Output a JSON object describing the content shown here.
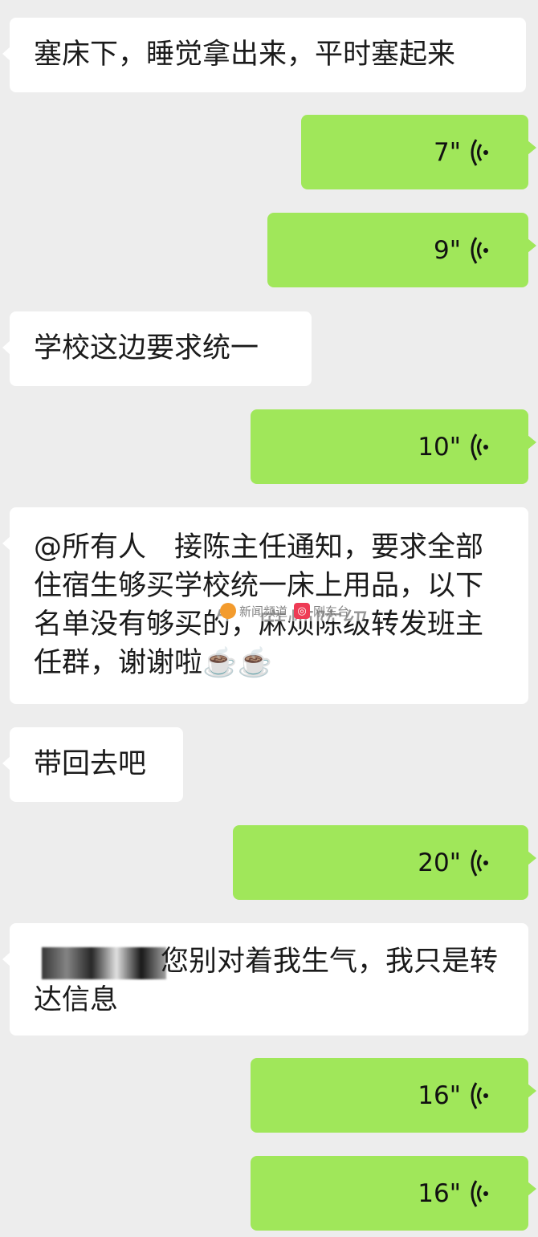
{
  "messages": [
    {
      "side": "in",
      "text": "塞床下，睡觉拿出来，平时塞起来"
    },
    {
      "side": "out",
      "duration": "7\""
    },
    {
      "side": "out",
      "duration": "9\""
    },
    {
      "side": "in",
      "text": "学校这边要求统一"
    },
    {
      "side": "out",
      "duration": "10\""
    },
    {
      "side": "in",
      "text": "@所有人　接陈主任通知，要求全部住宿生够买学校统一床上用品，以下名单没有够买的，麻烦陈级转发班主任群，谢谢啦☕️☕️"
    },
    {
      "side": "in",
      "text": "带回去吧"
    },
    {
      "side": "out",
      "duration": "20\""
    },
    {
      "side": "in",
      "text": "您别对着我生气，我只是转达信息"
    },
    {
      "side": "out",
      "duration": "16\""
    },
    {
      "side": "out",
      "duration": "16\""
    }
  ],
  "watermark": {
    "left": "新闻频道",
    "right": "刚东台"
  },
  "icons": {
    "voice": "voice-wave-icon"
  },
  "colors": {
    "background": "#ededed",
    "incoming": "#ffffff",
    "outgoing": "#a0e75a"
  }
}
